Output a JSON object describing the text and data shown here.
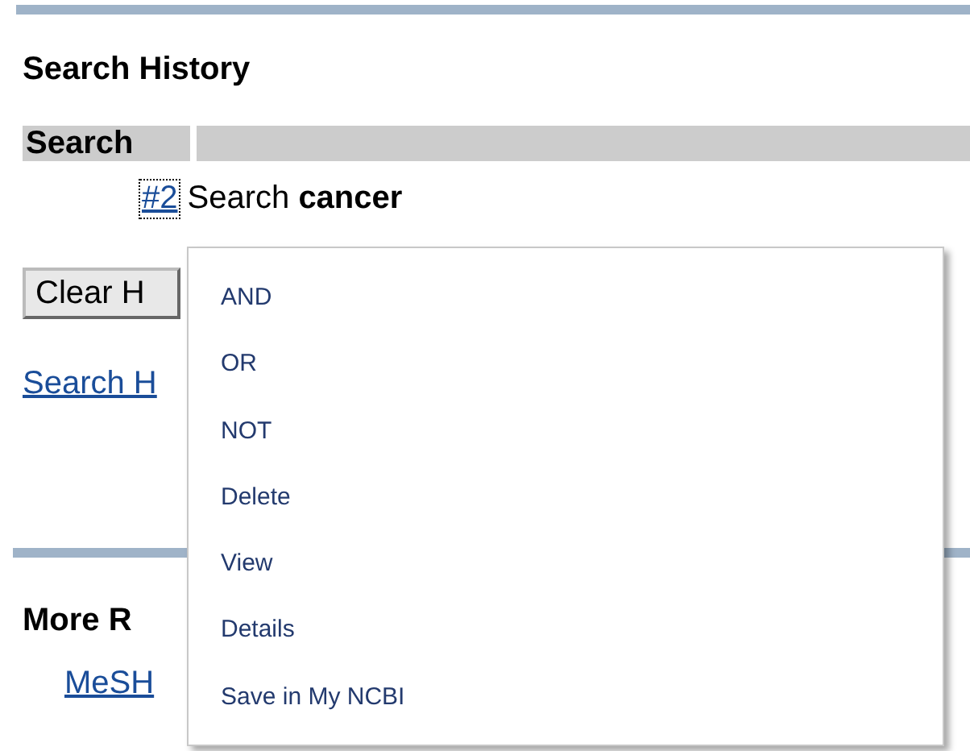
{
  "section_title": "Search History",
  "table": {
    "columns": [
      "Search",
      ""
    ],
    "rows": [
      {
        "number": "#2",
        "query": "Search **cancer**",
        "focused": true
      }
    ]
  },
  "clear_button": "Clear H",
  "history_link": "Search H",
  "more_title": "More R",
  "more_links": [
    "MeSH"
  ],
  "context_menu": {
    "items": [
      {
        "label": "AND"
      },
      {
        "label": "OR"
      },
      {
        "label": "NOT"
      },
      {
        "label": "Delete"
      },
      {
        "label": "View"
      },
      {
        "label": "Details"
      },
      {
        "label": "Save in My NCBI"
      }
    ]
  }
}
